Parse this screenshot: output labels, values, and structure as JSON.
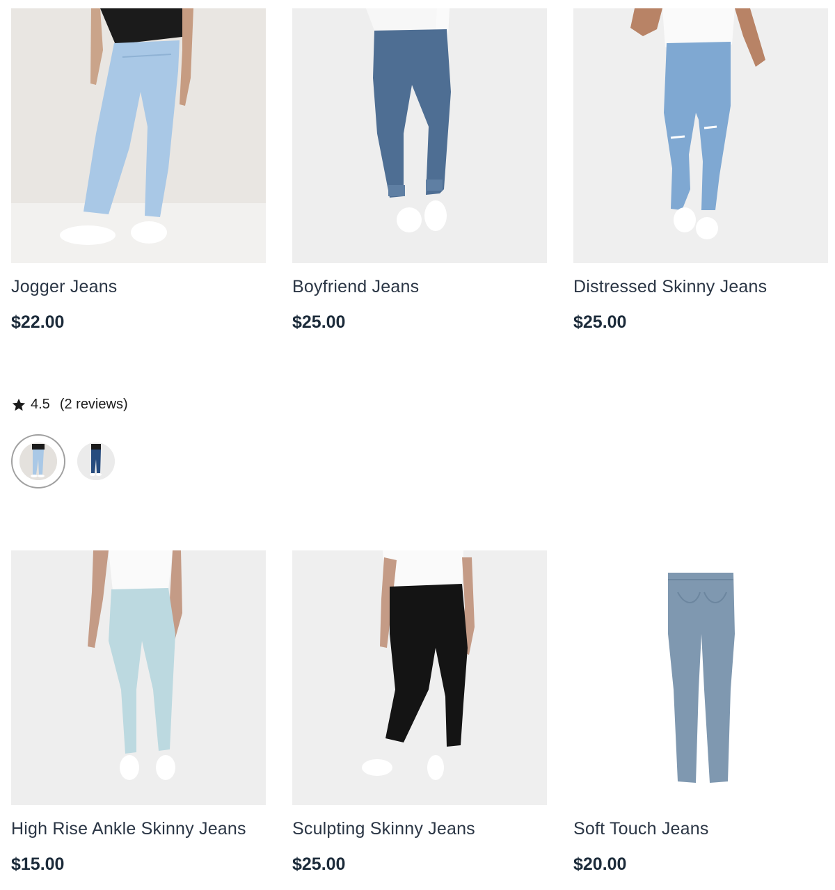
{
  "products": [
    {
      "title": "Jogger Jeans",
      "price": "$22.00",
      "image_icon": "jogger-jeans-model-photo",
      "denim_color": "#a9c8e6"
    },
    {
      "title": "Boyfriend Jeans",
      "price": "$25.00",
      "image_icon": "boyfriend-jeans-model-photo",
      "denim_color": "#4e6e93"
    },
    {
      "title": "Distressed Skinny Jeans",
      "price": "$25.00",
      "image_icon": "distressed-skinny-jeans-model-photo",
      "denim_color": "#7fa8d2"
    },
    {
      "title": "High Rise Ankle Skinny Jeans",
      "price": "$15.00",
      "image_icon": "high-rise-ankle-skinny-jeans-model-photo",
      "denim_color": "#bcd9e0"
    },
    {
      "title": "Sculpting Skinny Jeans",
      "price": "$25.00",
      "image_icon": "sculpting-skinny-jeans-model-photo",
      "denim_color": "#141414"
    },
    {
      "title": "Soft Touch Jeans",
      "price": "$20.00",
      "image_icon": "soft-touch-jeans-product-photo",
      "denim_color": "#7f98b0"
    }
  ],
  "rating": {
    "icon": "star-icon",
    "score": "4.5",
    "reviews": "(2 reviews)"
  },
  "swatches": [
    {
      "name": "light-blue",
      "selected": true,
      "color": "#a9c8e6"
    },
    {
      "name": "dark-blue",
      "selected": false,
      "color": "#274c7e"
    }
  ]
}
